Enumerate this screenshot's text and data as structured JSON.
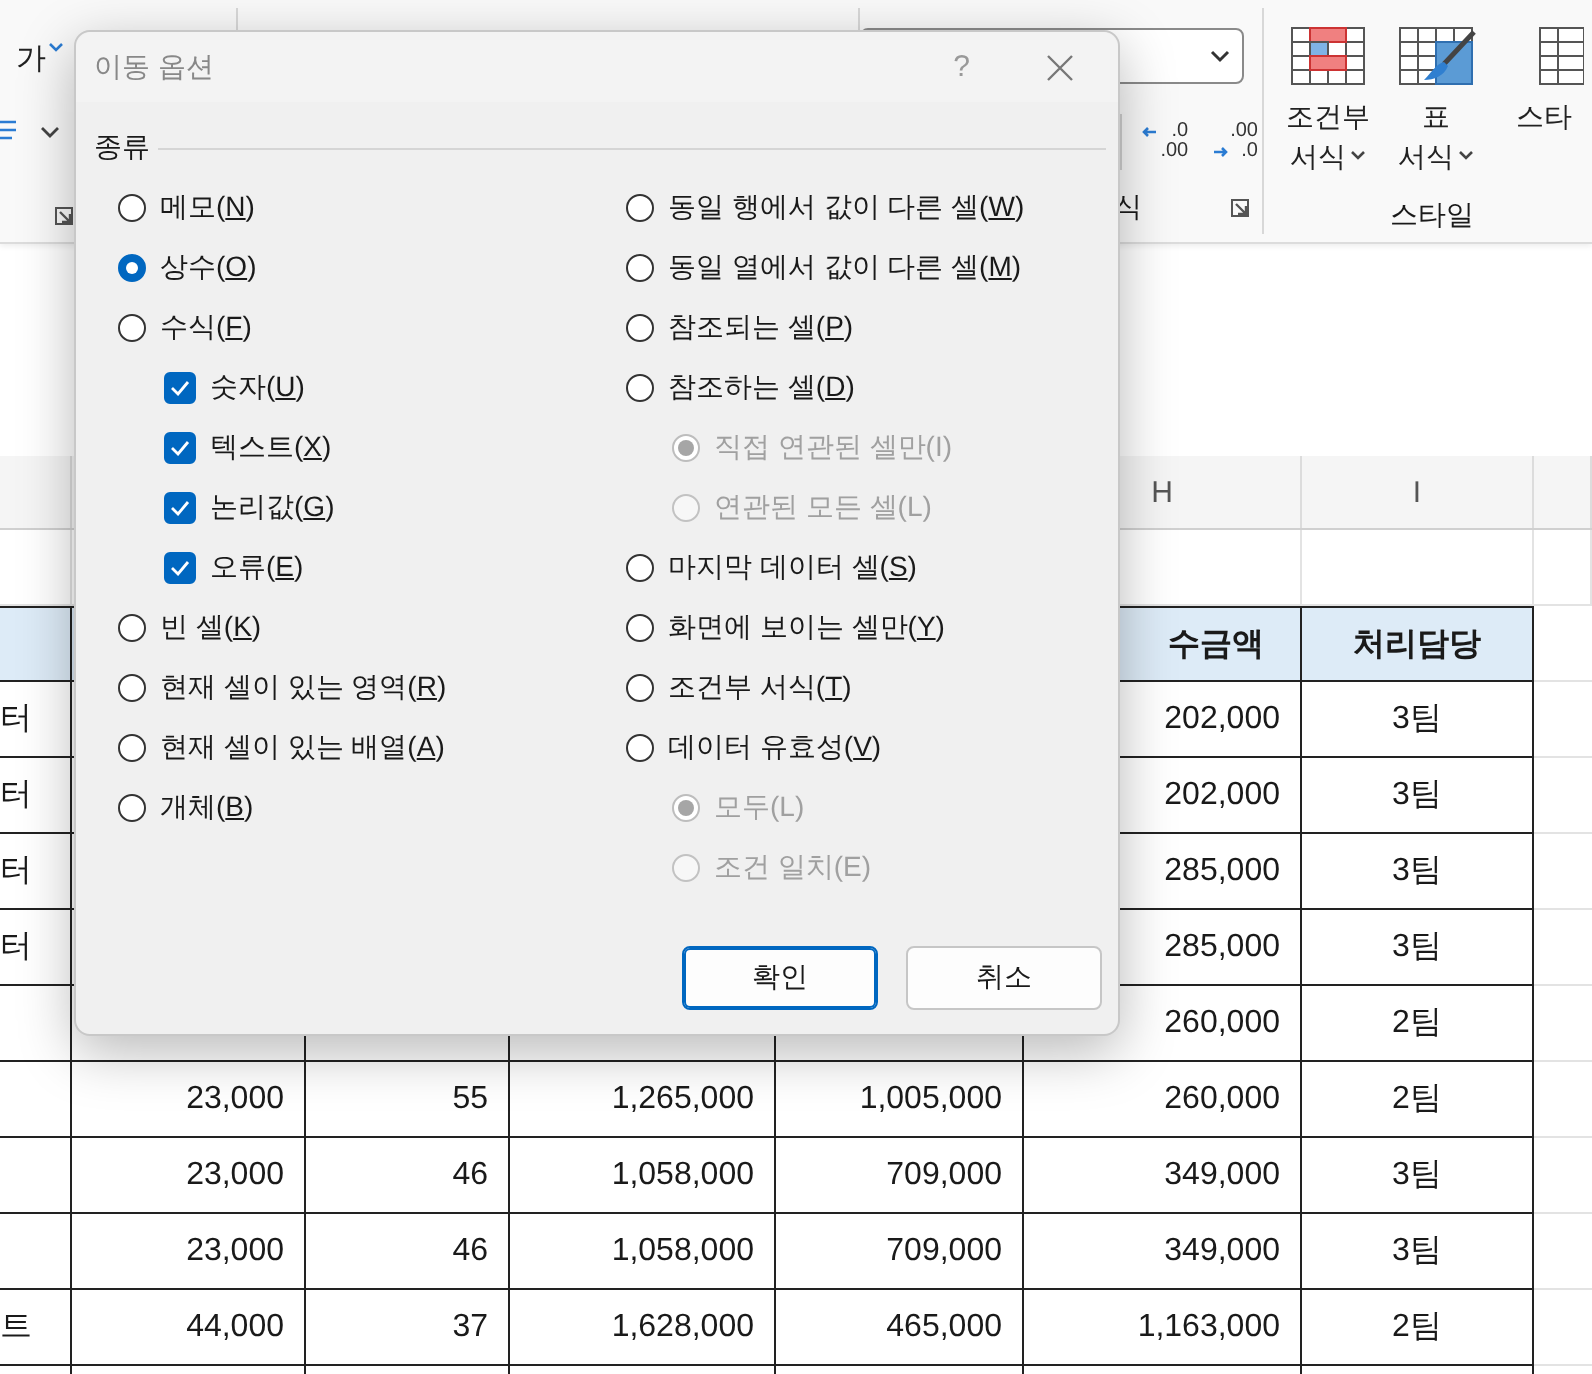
{
  "ribbon": {
    "phonetic_button": "가",
    "number_format_field": {
      "expanded": false
    },
    "decimal_buttons": [
      {
        "top": ".0",
        "bottom": ".00"
      },
      {
        "top": ".00",
        "bottom": ".0"
      }
    ],
    "number_group_label": "식",
    "style_buttons": [
      {
        "kind": "conditional",
        "line_1": "조건부",
        "line_2": "서식"
      },
      {
        "kind": "table",
        "line_1": "표",
        "line_2": "서식"
      },
      {
        "kind": "cell",
        "line_2": "스타"
      }
    ],
    "styles_group_label": "스타일"
  },
  "column_headers": {
    "column_5": "H",
    "column_6": "I"
  },
  "rows": [
    {
      "kind": "blank",
      "cells": {}
    },
    {
      "kind": "header",
      "cells": {
        "column_5": "수금액",
        "column_6": "처리담당"
      }
    },
    {
      "kind": "data",
      "cells": {
        "column_0": "터",
        "column_5": "202,000",
        "column_6": "3팀"
      }
    },
    {
      "kind": "data",
      "cells": {
        "column_0": "터",
        "column_5": "202,000",
        "column_6": "3팀"
      }
    },
    {
      "kind": "data",
      "cells": {
        "column_0": "터",
        "column_5": "285,000",
        "column_6": "3팀"
      }
    },
    {
      "kind": "data",
      "cells": {
        "column_0": "터",
        "column_5": "285,000",
        "column_6": "3팀"
      }
    },
    {
      "kind": "data",
      "cells": {
        "column_5": "260,000",
        "column_6": "2팀"
      }
    },
    {
      "kind": "data",
      "cells": {
        "column_1": "23,000",
        "column_2": "55",
        "column_3": "1,265,000",
        "column_4": "1,005,000",
        "column_5": "260,000",
        "column_6": "2팀"
      }
    },
    {
      "kind": "data",
      "cells": {
        "column_1": "23,000",
        "column_2": "46",
        "column_3": "1,058,000",
        "column_4": "709,000",
        "column_5": "349,000",
        "column_6": "3팀"
      }
    },
    {
      "kind": "data",
      "cells": {
        "column_1": "23,000",
        "column_2": "46",
        "column_3": "1,058,000",
        "column_4": "709,000",
        "column_5": "349,000",
        "column_6": "3팀"
      }
    },
    {
      "kind": "data",
      "cells": {
        "column_0": "트",
        "column_1": "44,000",
        "column_2": "37",
        "column_3": "1,628,000",
        "column_4": "465,000",
        "column_5": "1,163,000",
        "column_6": "2팀"
      }
    },
    {
      "kind": "data",
      "cells": {}
    }
  ],
  "dialog": {
    "title": "이동 옵션",
    "help": "?",
    "group_label": "종류",
    "left_options": [
      {
        "kind": "radio",
        "label": "메모(N)",
        "selected": false,
        "disabled": false
      },
      {
        "kind": "radio",
        "label": "상수(O)",
        "selected": true,
        "disabled": false
      },
      {
        "kind": "radio",
        "label": "수식(F)",
        "selected": false,
        "disabled": false,
        "children": [
          {
            "kind": "checkbox",
            "label": "숫자(U)",
            "checked": true,
            "disabled": false
          },
          {
            "kind": "checkbox",
            "label": "텍스트(X)",
            "checked": true,
            "disabled": false
          },
          {
            "kind": "checkbox",
            "label": "논리값(G)",
            "checked": true,
            "disabled": false
          },
          {
            "kind": "checkbox",
            "label": "오류(E)",
            "checked": true,
            "disabled": false
          }
        ]
      },
      {
        "kind": "radio",
        "label": "빈 셀(K)",
        "selected": false,
        "disabled": false
      },
      {
        "kind": "radio",
        "label": "현재 셀이 있는 영역(R)",
        "selected": false,
        "disabled": false
      },
      {
        "kind": "radio",
        "label": "현재 셀이 있는 배열(A)",
        "selected": false,
        "disabled": false
      },
      {
        "kind": "radio",
        "label": "개체(B)",
        "selected": false,
        "disabled": false
      }
    ],
    "right_options": [
      {
        "kind": "radio",
        "label": "동일 행에서 값이 다른 셀(W)",
        "selected": false,
        "disabled": false
      },
      {
        "kind": "radio",
        "label": "동일 열에서 값이 다른 셀(M)",
        "selected": false,
        "disabled": false
      },
      {
        "kind": "radio",
        "label": "참조되는 셀(P)",
        "selected": false,
        "disabled": false
      },
      {
        "kind": "radio",
        "label": "참조하는 셀(D)",
        "selected": false,
        "disabled": false,
        "children": [
          {
            "kind": "radio",
            "label": "직접 연관된 셀만(I)",
            "selected": true,
            "disabled": true
          },
          {
            "kind": "radio",
            "label": "연관된 모든 셀(L)",
            "selected": false,
            "disabled": true
          }
        ]
      },
      {
        "kind": "radio",
        "label": "마지막 데이터 셀(S)",
        "selected": false,
        "disabled": false
      },
      {
        "kind": "radio",
        "label": "화면에 보이는 셀만(Y)",
        "selected": false,
        "disabled": false
      },
      {
        "kind": "radio",
        "label": "조건부 서식(T)",
        "selected": false,
        "disabled": false
      },
      {
        "kind": "radio",
        "label": "데이터 유효성(V)",
        "selected": false,
        "disabled": false,
        "children": [
          {
            "kind": "radio",
            "label": "모두(L)",
            "selected": true,
            "disabled": true
          },
          {
            "kind": "radio",
            "label": "조건 일치(E)",
            "selected": false,
            "disabled": true
          }
        ]
      }
    ],
    "buttons": [
      {
        "label": "확인",
        "default": true
      },
      {
        "label": "취소",
        "default": false
      }
    ]
  }
}
